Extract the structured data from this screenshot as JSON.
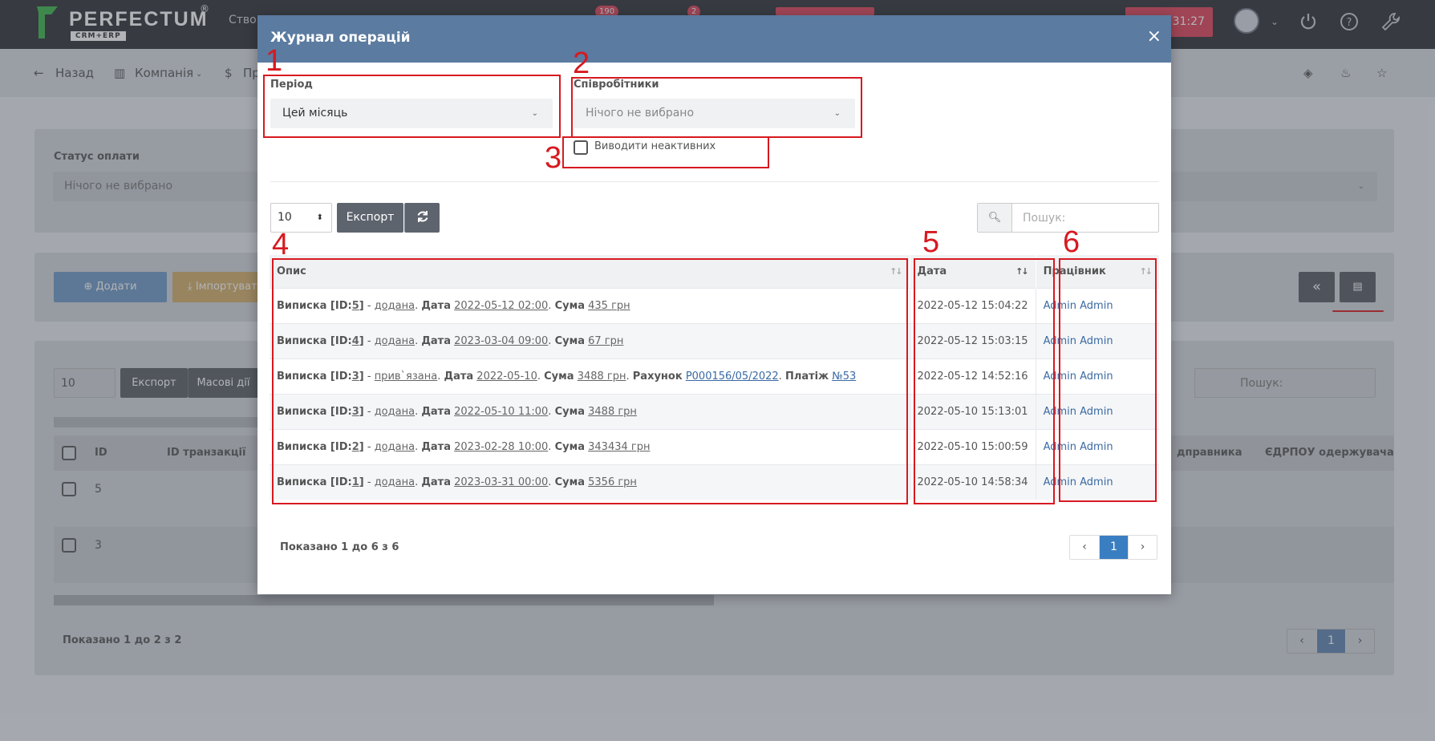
{
  "app": {
    "brand": "PERFECTUM",
    "brand_sub": "CRM+ERP",
    "brand_reg": "®",
    "create_label": "Створ",
    "badge_1": "190",
    "badge_2": "2",
    "timer": "31:27"
  },
  "subnav": {
    "back": "Назад",
    "company": "Компанія",
    "finance": "Пр"
  },
  "background": {
    "payment_status_label": "Статус оплати",
    "payment_status_value": "Нічого не вибрано",
    "add_button": "Додати",
    "import_button": "Імпортувати",
    "page_len": "10",
    "export_button": "Експорт",
    "bulk_button": "Масові дії",
    "search_placeholder": "Пошук:",
    "columns": [
      "ID",
      "ID транзакції",
      "дправника",
      "ЄДРПОУ одержувача"
    ],
    "rows": [
      "5",
      "3"
    ],
    "info": "Показано 1 до 2 з 2",
    "page": "1",
    "collapse_label": "«"
  },
  "modal": {
    "title": "Журнал операцій",
    "close": "×",
    "period_label": "Період",
    "period_value": "Цей місяць",
    "employees_label": "Співробітники",
    "employees_value": "Нічого не вибрано",
    "inactive_label": "Виводити неактивних",
    "page_len": "10",
    "export_button": "Експорт",
    "search_placeholder": "Пошук:",
    "columns": {
      "description": "Опис",
      "date": "Дата",
      "employee": "Працівник"
    },
    "rows": [
      {
        "d1": "Виписка [ID:",
        "id": "5",
        "d2": "]",
        "sep": " - ",
        "action": "додана",
        "t1": ". ",
        "dl": "Дата",
        "dv": "2022-05-12 02:00",
        "t2": ". ",
        "sl": "Сума",
        "sv": "435 грн",
        "date": "2022-05-12 15:04:22",
        "employee": "Admin Admin"
      },
      {
        "d1": "Виписка [ID:",
        "id": "4",
        "d2": "]",
        "sep": " - ",
        "action": "додана",
        "t1": ". ",
        "dl": "Дата",
        "dv": "2023-03-04 09:00",
        "t2": ". ",
        "sl": "Сума",
        "sv": "67 грн",
        "date": "2022-05-12 15:03:15",
        "employee": "Admin Admin"
      },
      {
        "d1": "Виписка [ID:",
        "id": "3",
        "d2": "]",
        "sep": " - ",
        "action": "прив`язана",
        "t1": ". ",
        "dl": "Дата",
        "dv": "2022-05-10",
        "t2": ". ",
        "sl": "Сума",
        "sv": "3488 грн",
        "t3": ". ",
        "il": "Рахунок",
        "iv": "Р000156/05/2022",
        "t4": ". ",
        "pl": "Платіж",
        "pv": "№53",
        "date": "2022-05-12 14:52:16",
        "employee": "Admin Admin"
      },
      {
        "d1": "Виписка [ID:",
        "id": "3",
        "d2": "]",
        "sep": " - ",
        "action": "додана",
        "t1": ". ",
        "dl": "Дата",
        "dv": "2022-05-10 11:00",
        "t2": ". ",
        "sl": "Сума",
        "sv": "3488 грн",
        "date": "2022-05-10 15:13:01",
        "employee": "Admin Admin"
      },
      {
        "d1": "Виписка [ID:",
        "id": "2",
        "d2": "]",
        "sep": " - ",
        "action": "додана",
        "t1": ". ",
        "dl": "Дата",
        "dv": "2023-02-28 10:00",
        "t2": ". ",
        "sl": "Сума",
        "sv": "343434 грн",
        "date": "2022-05-10 15:00:59",
        "employee": "Admin Admin"
      },
      {
        "d1": "Виписка [ID:",
        "id": "1",
        "d2": "]",
        "sep": " - ",
        "action": "додана",
        "t1": ". ",
        "dl": "Дата",
        "dv": "2023-03-31 00:00",
        "t2": ". ",
        "sl": "Сума",
        "sv": "5356 грн",
        "date": "2022-05-10 14:58:34",
        "employee": "Admin Admin"
      }
    ],
    "info": "Показано 1 до 6 з 6",
    "pager": {
      "prev": "‹",
      "page": "1",
      "next": "›"
    }
  },
  "annotations": [
    "1",
    "2",
    "3",
    "4",
    "5",
    "6"
  ],
  "colors": {
    "header": "#5b7ba0",
    "annotation": "#d71920",
    "accent": "#3a7ec2",
    "dark_button": "#5e646d",
    "topbar": "#2d2f36"
  }
}
